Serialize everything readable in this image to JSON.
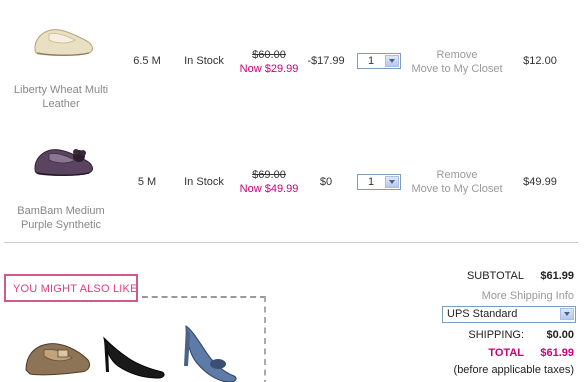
{
  "cart": {
    "items": [
      {
        "name": "Liberty Wheat Multi Leather",
        "size": "6.5 M",
        "stock": "In Stock",
        "was_price": "$60.00",
        "now_price": "Now $29.99",
        "discount": "-$17.99",
        "qty": "1",
        "remove_label": "Remove",
        "move_label": "Move to My Closet",
        "total": "$12.00",
        "thumb_icon": "flat-shoe-cream-icon"
      },
      {
        "name": "BamBam Medium Purple Synthetic",
        "size": "5 M",
        "stock": "In Stock",
        "was_price": "$69.00",
        "now_price": "Now $49.99",
        "discount": "$0",
        "qty": "1",
        "remove_label": "Remove",
        "move_label": "Move to My Closet",
        "total": "$49.99",
        "thumb_icon": "flat-shoe-purple-icon"
      }
    ]
  },
  "recommendations": {
    "title": "YOU MIGHT ALSO LIKE"
  },
  "summary": {
    "subtotal_label": "SUBTOTAL",
    "subtotal_value": "$61.99",
    "more_shipping_label": "More Shipping Info",
    "shipping_method": "UPS Standard",
    "shipping_label": "SHIPPING:",
    "shipping_value": "$0.00",
    "total_label": "TOTAL",
    "total_value": "$61.99",
    "tax_note": "(before applicable taxes)"
  },
  "colors": {
    "accent_pink": "#cc0077",
    "muted_gray": "#999999"
  }
}
